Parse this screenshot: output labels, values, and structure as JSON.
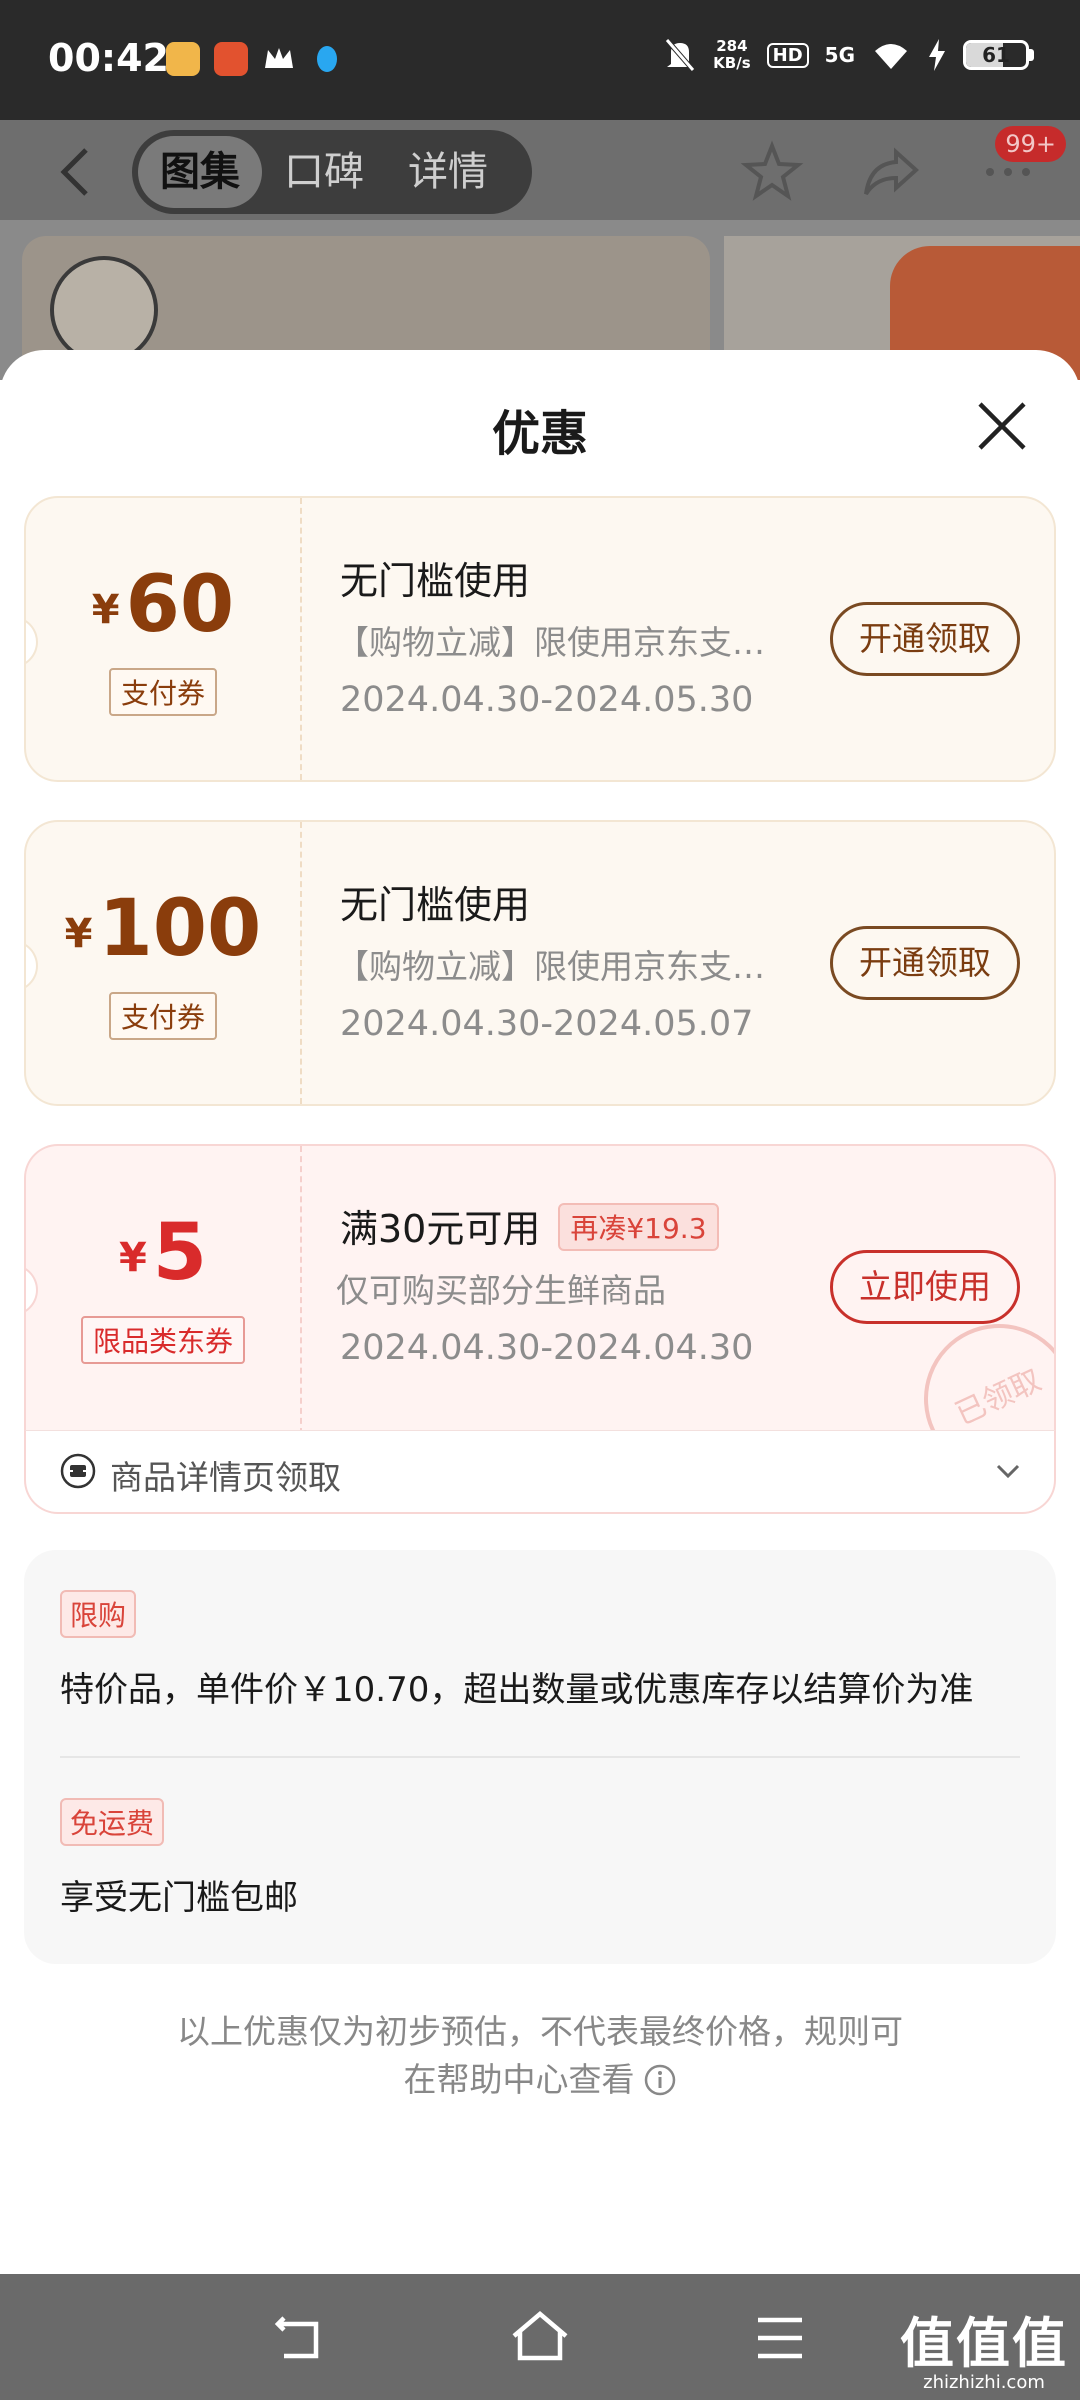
{
  "status_bar": {
    "time": "00:42",
    "net_speed_value": "284",
    "net_speed_unit": "KB/s",
    "hd_label": "HD",
    "network": "5G",
    "battery_level": "61",
    "battery_fraction": 0.61,
    "app_icons": [
      "chat-app-icon",
      "shop-app-icon",
      "crown-app-icon",
      "qq-penguin-icon"
    ]
  },
  "header": {
    "tabs": [
      {
        "label": "图集",
        "active": true
      },
      {
        "label": "口碑",
        "active": false
      },
      {
        "label": "详情",
        "active": false
      }
    ],
    "message_badge": "99+",
    "icons": [
      "back-icon",
      "star-icon",
      "share-icon",
      "more-icon"
    ]
  },
  "sheet": {
    "title": "优惠",
    "coupons": [
      {
        "currency": "¥",
        "amount": "60",
        "tag": "支付券",
        "title": "无门槛使用",
        "desc": "【购物立减】限使用京东支付…",
        "date": "2024.04.30-2024.05.30",
        "button": "开通领取"
      },
      {
        "currency": "¥",
        "amount": "100",
        "tag": "支付券",
        "title": "无门槛使用",
        "desc": "【购物立减】限使用京东支付…",
        "date": "2024.04.30-2024.05.07",
        "button": "开通领取"
      },
      {
        "currency": "¥",
        "amount": "5",
        "tag": "限品类东券",
        "title": "满30元可用",
        "extra": "再凑¥19.3",
        "desc": "仅可购买部分生鲜商品",
        "date": "2024.04.30-2024.04.30",
        "button": "立即使用",
        "stamp": "已领取"
      }
    ],
    "coupon_footer": "商品详情页领取",
    "info": [
      {
        "tag": "限购",
        "text": "特价品，单件价￥10.70，超出数量或优惠库存以结算价为准"
      },
      {
        "tag": "免运费",
        "text": "享受无门槛包邮"
      }
    ],
    "disclaimer_line1": "以上优惠仅为初步预估，不代表最终价格，规则可",
    "disclaimer_line2": "在帮助中心查看"
  },
  "watermark": {
    "main": "值值值",
    "sub": "zhizhizhi.com"
  },
  "colors": {
    "coupon_brown": "#8a3d0c",
    "coupon_red": "#d92b2b",
    "coupon_bg": "#fdf8f1",
    "coupon_red_bg": "#fff3f2"
  }
}
